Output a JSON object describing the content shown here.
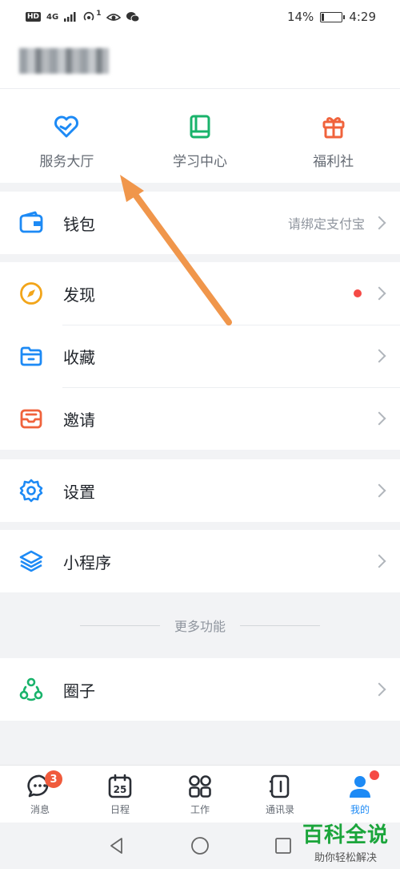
{
  "status_bar": {
    "left_badges": [
      "HD",
      "4G",
      "1"
    ],
    "battery": "14%",
    "battery_level": 0.14,
    "time": "4:29"
  },
  "quick_actions": [
    {
      "label": "服务大厅",
      "icon": "heart-hand-icon",
      "color": "#1d8af5"
    },
    {
      "label": "学习中心",
      "icon": "book-icon",
      "color": "#19b36b"
    },
    {
      "label": "福利社",
      "icon": "gift-icon",
      "color": "#f0633c"
    }
  ],
  "menu": {
    "wallet": {
      "label": "钱包",
      "extra": "请绑定支付宝",
      "icon": "wallet-icon"
    },
    "discover": {
      "label": "发现",
      "icon": "compass-icon"
    },
    "favorites": {
      "label": "收藏",
      "icon": "folder-icon"
    },
    "invite": {
      "label": "邀请",
      "icon": "inbox-icon"
    },
    "settings": {
      "label": "设置",
      "icon": "gear-icon"
    },
    "mini_programs": {
      "label": "小程序",
      "icon": "layers-icon"
    },
    "more_divider": "更多功能",
    "circles": {
      "label": "圈子",
      "icon": "people-circle-icon"
    }
  },
  "tabbar": [
    {
      "label": "消息",
      "icon": "chat-icon",
      "badge": "3"
    },
    {
      "label": "日程",
      "icon": "calendar-icon",
      "day": "25"
    },
    {
      "label": "工作",
      "icon": "apps-grid-icon"
    },
    {
      "label": "通讯录",
      "icon": "contacts-icon"
    },
    {
      "label": "我的",
      "icon": "profile-icon",
      "active": true
    }
  ],
  "watermark": {
    "title": "百科全说",
    "subtitle": "助你轻松解决"
  },
  "colors": {
    "accent": "#1d8af5",
    "arrow": "#f0964b",
    "red_dot": "#f54a45"
  }
}
